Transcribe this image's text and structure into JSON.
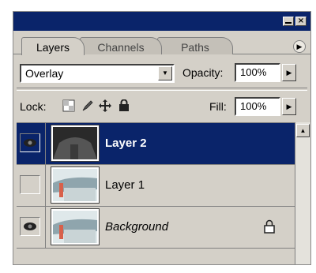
{
  "panel": {
    "tabs": [
      {
        "label": "Layers",
        "active": true
      },
      {
        "label": "Channels",
        "active": false
      },
      {
        "label": "Paths",
        "active": false
      }
    ],
    "window_buttons": {
      "minimize": "minimize-icon",
      "close": "close-icon"
    },
    "menu_icon": "flyout-menu-icon"
  },
  "blend": {
    "mode": "Overlay"
  },
  "opacity": {
    "label": "Opacity:",
    "value": "100%"
  },
  "lock": {
    "label": "Lock:",
    "icons": [
      "lock-transparency-icon",
      "lock-image-icon",
      "lock-position-icon",
      "lock-all-icon"
    ]
  },
  "fill": {
    "label": "Fill:",
    "value": "100%"
  },
  "layers": [
    {
      "name": "Layer 2",
      "selected": true,
      "visible": true,
      "italic": false,
      "locked": false
    },
    {
      "name": "Layer 1",
      "selected": false,
      "visible": false,
      "italic": false,
      "locked": false
    },
    {
      "name": "Background",
      "selected": false,
      "visible": true,
      "italic": true,
      "locked": true
    }
  ],
  "colors": {
    "titlebar": "#0a246a",
    "selection": "#0a246a",
    "panel_bg": "#d4d0c8"
  }
}
